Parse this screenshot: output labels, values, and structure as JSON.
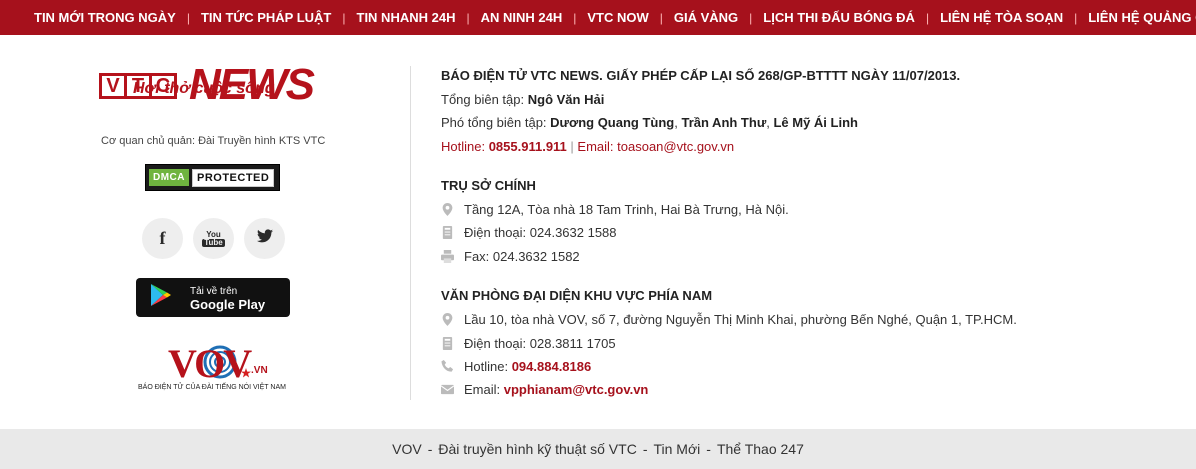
{
  "nav": {
    "items": [
      "TIN MỚI TRONG NGÀY",
      "TIN TỨC PHÁP LUẬT",
      "TIN NHANH 24H",
      "AN NINH 24H",
      "VTC NOW",
      "GIÁ VÀNG",
      "LỊCH THI ĐẤU BÓNG ĐÁ",
      "LIÊN HỆ TÒA SOẠN",
      "LIÊN HỆ QUẢNG CÁO"
    ],
    "separator": "|"
  },
  "brand": {
    "logo_vtc": [
      "V",
      "T",
      "C"
    ],
    "logo_news": "NEWS",
    "slogan": "Hơi thở cuộc sống",
    "owner": "Cơ quan chủ quản: Đài Truyền hình KTS VTC",
    "dmca_left": "DMCA",
    "dmca_right": "PROTECTED"
  },
  "social": {
    "facebook_glyph": "f",
    "youtube_glyph_top": "You",
    "youtube_glyph_bottom": "Tube"
  },
  "google_play": {
    "small": "Tải về trên",
    "big": "Google Play"
  },
  "vov": {
    "letters": "VOV",
    "suffix": ".VN",
    "caption": "BÁO ĐIỆN TỬ CỦA ĐÀI TIẾNG NÓI VIỆT NAM"
  },
  "info": {
    "license": "BÁO ĐIỆN TỬ VTC NEWS. GIẤY PHÉP CẤP LẠI SỐ 268/GP-BTTTT NGÀY 11/07/2013.",
    "editor_label": "Tổng biên tập: ",
    "editor_name": "Ngô Văn Hải",
    "deputy_label": "Phó tổng biên tập: ",
    "deputy_1": "Dương Quang Tùng",
    "deputy_2": "Trần Anh Thư",
    "deputy_3": "Lê Mỹ Ái Linh",
    "deputy_sep": ", ",
    "hotline_label": "Hotline: ",
    "hotline": "0855.911.911",
    "pipe": " | ",
    "email_label": "Email: ",
    "email": "toasoan@vtc.gov.vn"
  },
  "hq": {
    "title": "TRỤ SỞ CHÍNH",
    "address": "Tầng 12A, Tòa nhà 18 Tam Trinh, Hai Bà Trưng, Hà Nội.",
    "phone": "Điện thoại: 024.3632 1588",
    "fax": "Fax: 024.3632 1582"
  },
  "south": {
    "title": "VĂN PHÒNG ĐẠI DIỆN KHU VỰC PHÍA NAM",
    "address": "Lầu 10, tòa nhà VOV, số 7, đường Nguyễn Thị Minh Khai, phường Bến Nghé, Quận 1, TP.HCM.",
    "phone": "Điện thoại: 028.3811 1705",
    "hotline_label": "Hotline: ",
    "hotline": "094.884.8186",
    "email_label": "Email: ",
    "email": "vpphianam@vtc.gov.vn"
  },
  "footer": {
    "links": [
      "VOV",
      "Đài truyền hình kỹ thuật số VTC",
      "Tin Mới",
      "Thể Thao 247"
    ],
    "separator": "-"
  },
  "colors": {
    "brand_red": "#a6111c",
    "footer_bg": "#e9e9e9"
  }
}
